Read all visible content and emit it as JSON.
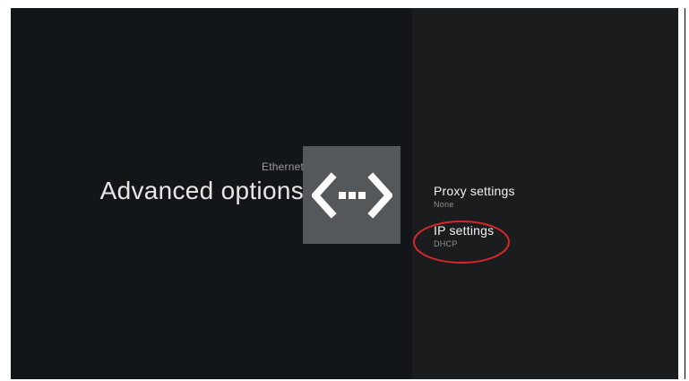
{
  "header": {
    "breadcrumb": "Ethernet",
    "title": "Advanced options"
  },
  "icon": {
    "name": "ethernet-icon",
    "tile_color": "#55585b",
    "glyph_color": "#ffffff"
  },
  "settings": {
    "items": [
      {
        "title": "Proxy settings",
        "subtitle": "None"
      },
      {
        "title": "IP settings",
        "subtitle": "DHCP"
      }
    ]
  },
  "annotation": {
    "color": "#d6282b"
  }
}
